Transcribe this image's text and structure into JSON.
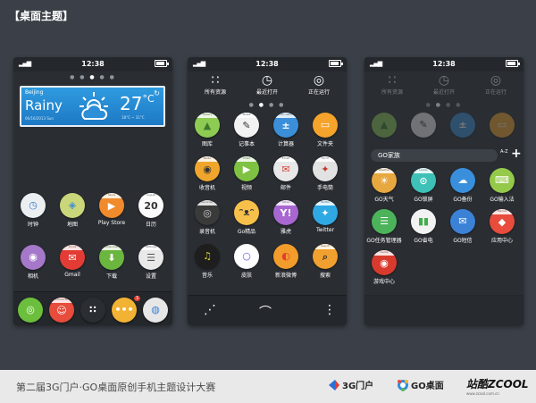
{
  "page_title": "【桌面主题】",
  "status": {
    "time": "12:38"
  },
  "phone1": {
    "weather": {
      "city": "Beijing",
      "condition": "Rainy",
      "date": "06/16/2013 Sun",
      "temp": "27",
      "unit": "°C",
      "range": "18°C ~ 31°C"
    },
    "apps": [
      {
        "label": "时钟",
        "band": "",
        "sym": "◷",
        "color": "#eceff2",
        "fg": "#3d7cc9"
      },
      {
        "label": "地图",
        "band": "",
        "sym": "◈",
        "color": "#c9d67a",
        "fg": "#3f8fd6"
      },
      {
        "label": "Play Store",
        "band": "Store",
        "sym": "▶",
        "color": "#f08a2c",
        "fg": "#ffffff"
      },
      {
        "label": "日历",
        "band": "August",
        "sym": "20",
        "color": "#fbfbfb",
        "fg": "#333333"
      },
      {
        "label": "相机",
        "band": "",
        "sym": "◉",
        "color": "#a678c9",
        "fg": "#ffffff"
      },
      {
        "label": "Gmail",
        "band": "Gmail",
        "sym": "✉",
        "color": "#e23c34",
        "fg": "#ffffff"
      },
      {
        "label": "下载",
        "band": "Download",
        "sym": "⬇",
        "color": "#6ab63f",
        "fg": "#ffffff"
      },
      {
        "label": "设置",
        "band": "Settings",
        "sym": "☰",
        "color": "#e9e9e9",
        "fg": "#555555"
      }
    ],
    "dock": [
      {
        "label": "",
        "band": "",
        "sym": "◎",
        "color": "#6bbf3d",
        "fg": "#ffffff"
      },
      {
        "label": "",
        "band": "Contacts",
        "sym": "☺",
        "color": "#e74c3c",
        "fg": "#ffffff"
      },
      {
        "label": "",
        "band": "",
        "sym": "∷",
        "color": "#2a2e33",
        "fg": "#ffffff"
      },
      {
        "label": "",
        "band": "",
        "sym": "•••",
        "color": "#f2b233",
        "fg": "#ffffff",
        "badge": "3"
      },
      {
        "label": "",
        "band": "",
        "sym": "◍",
        "color": "#e7e7e7",
        "fg": "#3b82d6"
      }
    ]
  },
  "phone2": {
    "tabs": [
      {
        "label": "所有资源",
        "glyph": "∷"
      },
      {
        "label": "最近打开",
        "glyph": "◷"
      },
      {
        "label": "正在运行",
        "glyph": "◎"
      }
    ],
    "apps": [
      {
        "label": "图库",
        "band": "Gallery",
        "sym": "▲",
        "color": "#8ecb53",
        "fg": "#3b7a2b"
      },
      {
        "label": "记事本",
        "band": "Notes",
        "sym": "✎",
        "color": "#f2f2f2",
        "fg": "#333333"
      },
      {
        "label": "计算器",
        "band": "Calculator",
        "sym": "±",
        "color": "#3b8fd9",
        "fg": "#ffffff"
      },
      {
        "label": "文件夹",
        "band": "",
        "sym": "▭",
        "color": "#f6a32b",
        "fg": "#ffffff"
      },
      {
        "label": "收音机",
        "band": "Radio",
        "sym": "◉",
        "color": "#f0a62c",
        "fg": "#333333"
      },
      {
        "label": "视频",
        "band": "Video",
        "sym": "▶",
        "color": "#7fc243",
        "fg": "#ffffff"
      },
      {
        "label": "邮件",
        "band": "Email",
        "sym": "✉",
        "color": "#e8e8e8",
        "fg": "#d94335"
      },
      {
        "label": "手电筒",
        "band": "Torch",
        "sym": "✦",
        "color": "#e2e2e2",
        "fg": "#c0392b"
      },
      {
        "label": "录音机",
        "band": "Recorder",
        "sym": "◎",
        "color": "#3a3a3a",
        "fg": "#cccccc"
      },
      {
        "label": "Go精品",
        "band": "",
        "sym": "ᵔᴥᵔ",
        "color": "#f7c04b",
        "fg": "#333333"
      },
      {
        "label": "雅虎",
        "band": "Yahoo",
        "sym": "Y!",
        "color": "#a866d0",
        "fg": "#ffffff"
      },
      {
        "label": "Twitter",
        "band": "Twitter",
        "sym": "✦",
        "color": "#2fa9e4",
        "fg": "#ffffff"
      },
      {
        "label": "音乐",
        "band": "",
        "sym": "♫",
        "color": "#1e1e1e",
        "fg": "#d8d12d"
      },
      {
        "label": "皮肤",
        "band": "",
        "sym": "○",
        "color": "#ffffff",
        "fg": "#6a5bd6"
      },
      {
        "label": "新浪微博",
        "band": "",
        "sym": "◐",
        "color": "#f29c2b",
        "fg": "#e23c34"
      },
      {
        "label": "搜索",
        "band": "Search",
        "sym": "⌕",
        "color": "#f0a02e",
        "fg": "#333333"
      }
    ],
    "bottom": [
      "⋰",
      "⌒",
      "⋮"
    ]
  },
  "phone3": {
    "tabs": [
      {
        "label": "所有资源",
        "glyph": "∷"
      },
      {
        "label": "最近打开",
        "glyph": "◷"
      },
      {
        "label": "正在运行",
        "glyph": "◎"
      }
    ],
    "dim_apps": [
      {
        "label": "",
        "band": "",
        "sym": "▲",
        "color": "#8ecb53",
        "fg": "#3b7a2b"
      },
      {
        "label": "",
        "band": "",
        "sym": "✎",
        "color": "#f2f2f2",
        "fg": "#333333"
      },
      {
        "label": "",
        "band": "",
        "sym": "±",
        "color": "#3b8fd9",
        "fg": "#ffffff"
      },
      {
        "label": "",
        "band": "",
        "sym": "▭",
        "color": "#f6a32b",
        "fg": "#ffffff"
      }
    ],
    "folder": {
      "name": "GO家族",
      "sort_label": "A-Z",
      "add_label": "+"
    },
    "apps": [
      {
        "label": "GO天气",
        "band": "Weather",
        "sym": "☀",
        "color": "#e8a840",
        "fg": "#ffffff"
      },
      {
        "label": "GO锁屏",
        "band": "Locker",
        "sym": "⊙",
        "color": "#3ec1b6",
        "fg": "#ffffff"
      },
      {
        "label": "GO备份",
        "band": "",
        "sym": "☁",
        "color": "#3a8fdc",
        "fg": "#ffffff"
      },
      {
        "label": "GO输入法",
        "band": "",
        "sym": "⌨",
        "color": "#94c94a",
        "fg": "#ffffff"
      },
      {
        "label": "GO任务管理器",
        "band": "",
        "sym": "☰",
        "color": "#4cb35a",
        "fg": "#ffffff"
      },
      {
        "label": "GO省电",
        "band": "",
        "sym": "▮▮",
        "color": "#f2f2f2",
        "fg": "#3fae48"
      },
      {
        "label": "GO短信",
        "band": "",
        "sym": "✉",
        "color": "#3b82d6",
        "fg": "#ffffff"
      },
      {
        "label": "应用中心",
        "band": "Market",
        "sym": "◆",
        "color": "#e74c3c",
        "fg": "#ffffff"
      },
      {
        "label": "游戏中心",
        "band": "Game",
        "sym": "◉",
        "color": "#d83b2e",
        "fg": "#ffffff"
      }
    ]
  },
  "footer": {
    "text": "第二届3G门户·GO桌面原创手机主题设计大赛",
    "logo_3g": "3G门户",
    "logo_go": "GO桌面",
    "logo_zc": "站酷ZCOOL",
    "logo_zc_url": "www.zcool.com.cn"
  }
}
